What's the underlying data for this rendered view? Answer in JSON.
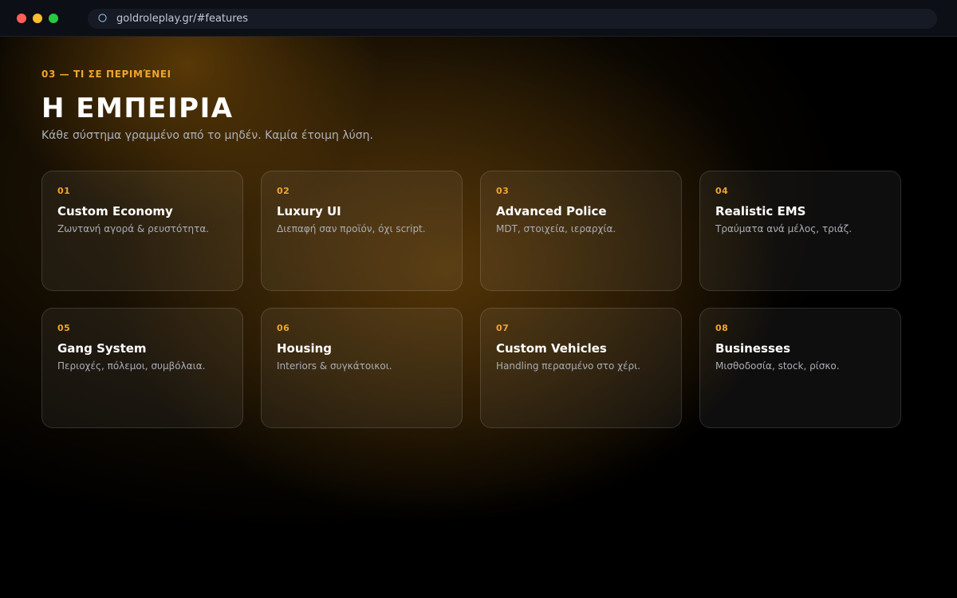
{
  "browser": {
    "url": "goldroleplay.gr/#features"
  },
  "section": {
    "eyebrow": "03 — ΤΙ ΣΕ ΠΕΡΙΜΈΝΕΙ",
    "title": "Η ΕΜΠΕΙΡΙΑ",
    "subtitle": "Κάθε σύστημα γραμμένο από το μηδέν. Καμία έτοιμη λύση."
  },
  "features": [
    {
      "num": "01",
      "title": "Custom Economy",
      "desc": "Ζωντανή αγορά & ρευστότητα."
    },
    {
      "num": "02",
      "title": "Luxury UI",
      "desc": "Διεπαφή σαν προϊόν, όχι script."
    },
    {
      "num": "03",
      "title": "Advanced Police",
      "desc": "MDT, στοιχεία, ιεραρχία."
    },
    {
      "num": "04",
      "title": "Realistic EMS",
      "desc": "Τραύματα ανά μέλος, τριάζ."
    },
    {
      "num": "05",
      "title": "Gang System",
      "desc": "Περιοχές, πόλεμοι, συμβόλαια."
    },
    {
      "num": "06",
      "title": "Housing",
      "desc": "Interiors & συγκάτοικοι."
    },
    {
      "num": "07",
      "title": "Custom Vehicles",
      "desc": "Handling περασμένο στο χέρι."
    },
    {
      "num": "08",
      "title": "Businesses",
      "desc": "Μισθοδοσία, stock, ρίσκο."
    }
  ],
  "colors": {
    "accent": "#f0a52e",
    "background": "#000000",
    "chrome": "#0c0f15"
  }
}
